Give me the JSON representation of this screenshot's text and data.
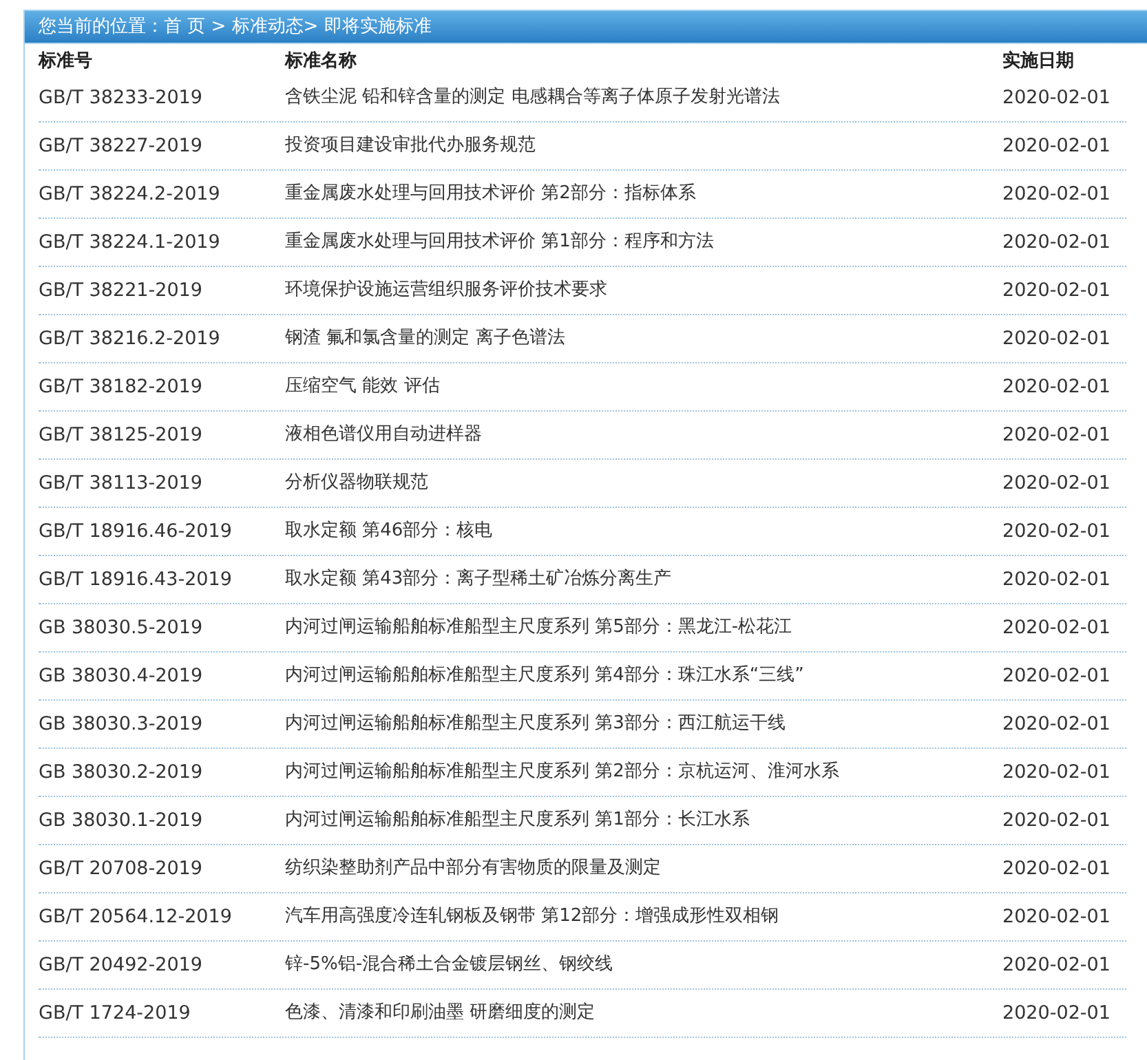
{
  "breadcrumb": "您当前的位置：首 页 > 标准动态> 即将实施标准",
  "table": {
    "columns": [
      "标准号",
      "标准名称",
      "实施日期"
    ],
    "rows": [
      [
        "GB/T 38233-2019",
        "含铁尘泥 铅和锌含量的测定 电感耦合等离子体原子发射光谱法",
        "2020-02-01"
      ],
      [
        "GB/T 38227-2019",
        "投资项目建设审批代办服务规范",
        "2020-02-01"
      ],
      [
        "GB/T 38224.2-2019",
        "重金属废水处理与回用技术评价 第2部分：指标体系",
        "2020-02-01"
      ],
      [
        "GB/T 38224.1-2019",
        "重金属废水处理与回用技术评价 第1部分：程序和方法",
        "2020-02-01"
      ],
      [
        "GB/T 38221-2019",
        "环境保护设施运营组织服务评价技术要求",
        "2020-02-01"
      ],
      [
        "GB/T 38216.2-2019",
        "钢渣 氟和氯含量的测定 离子色谱法",
        "2020-02-01"
      ],
      [
        "GB/T 38182-2019",
        "压缩空气 能效 评估",
        "2020-02-01"
      ],
      [
        "GB/T 38125-2019",
        "液相色谱仪用自动进样器",
        "2020-02-01"
      ],
      [
        "GB/T 38113-2019",
        "分析仪器物联规范",
        "2020-02-01"
      ],
      [
        "GB/T 18916.46-2019",
        "取水定额 第46部分：核电",
        "2020-02-01"
      ],
      [
        "GB/T 18916.43-2019",
        "取水定额 第43部分：离子型稀土矿冶炼分离生产",
        "2020-02-01"
      ],
      [
        "GB 38030.5-2019",
        "内河过闸运输船舶标准船型主尺度系列 第5部分：黑龙江-松花江",
        "2020-02-01"
      ],
      [
        "GB 38030.4-2019",
        "内河过闸运输船舶标准船型主尺度系列 第4部分：珠江水系“三线”",
        "2020-02-01"
      ],
      [
        "GB 38030.3-2019",
        "内河过闸运输船舶标准船型主尺度系列 第3部分：西江航运干线",
        "2020-02-01"
      ],
      [
        "GB 38030.2-2019",
        "内河过闸运输船舶标准船型主尺度系列 第2部分：京杭运河、淮河水系",
        "2020-02-01"
      ],
      [
        "GB 38030.1-2019",
        "内河过闸运输船舶标准船型主尺度系列 第1部分：长江水系",
        "2020-02-01"
      ],
      [
        "GB/T 20708-2019",
        "纺织染整助剂产品中部分有害物质的限量及测定",
        "2020-02-01"
      ],
      [
        "GB/T 20564.12-2019",
        "汽车用高强度冷连轧钢板及钢带 第12部分：增强成形性双相钢",
        "2020-02-01"
      ],
      [
        "GB/T 20492-2019",
        "锌-5%铝-混合稀土合金镀层钢丝、钢绞线",
        "2020-02-01"
      ],
      [
        "GB/T 1724-2019",
        "色漆、清漆和印刷油墨 研磨细度的测定",
        "2020-02-01"
      ]
    ]
  }
}
